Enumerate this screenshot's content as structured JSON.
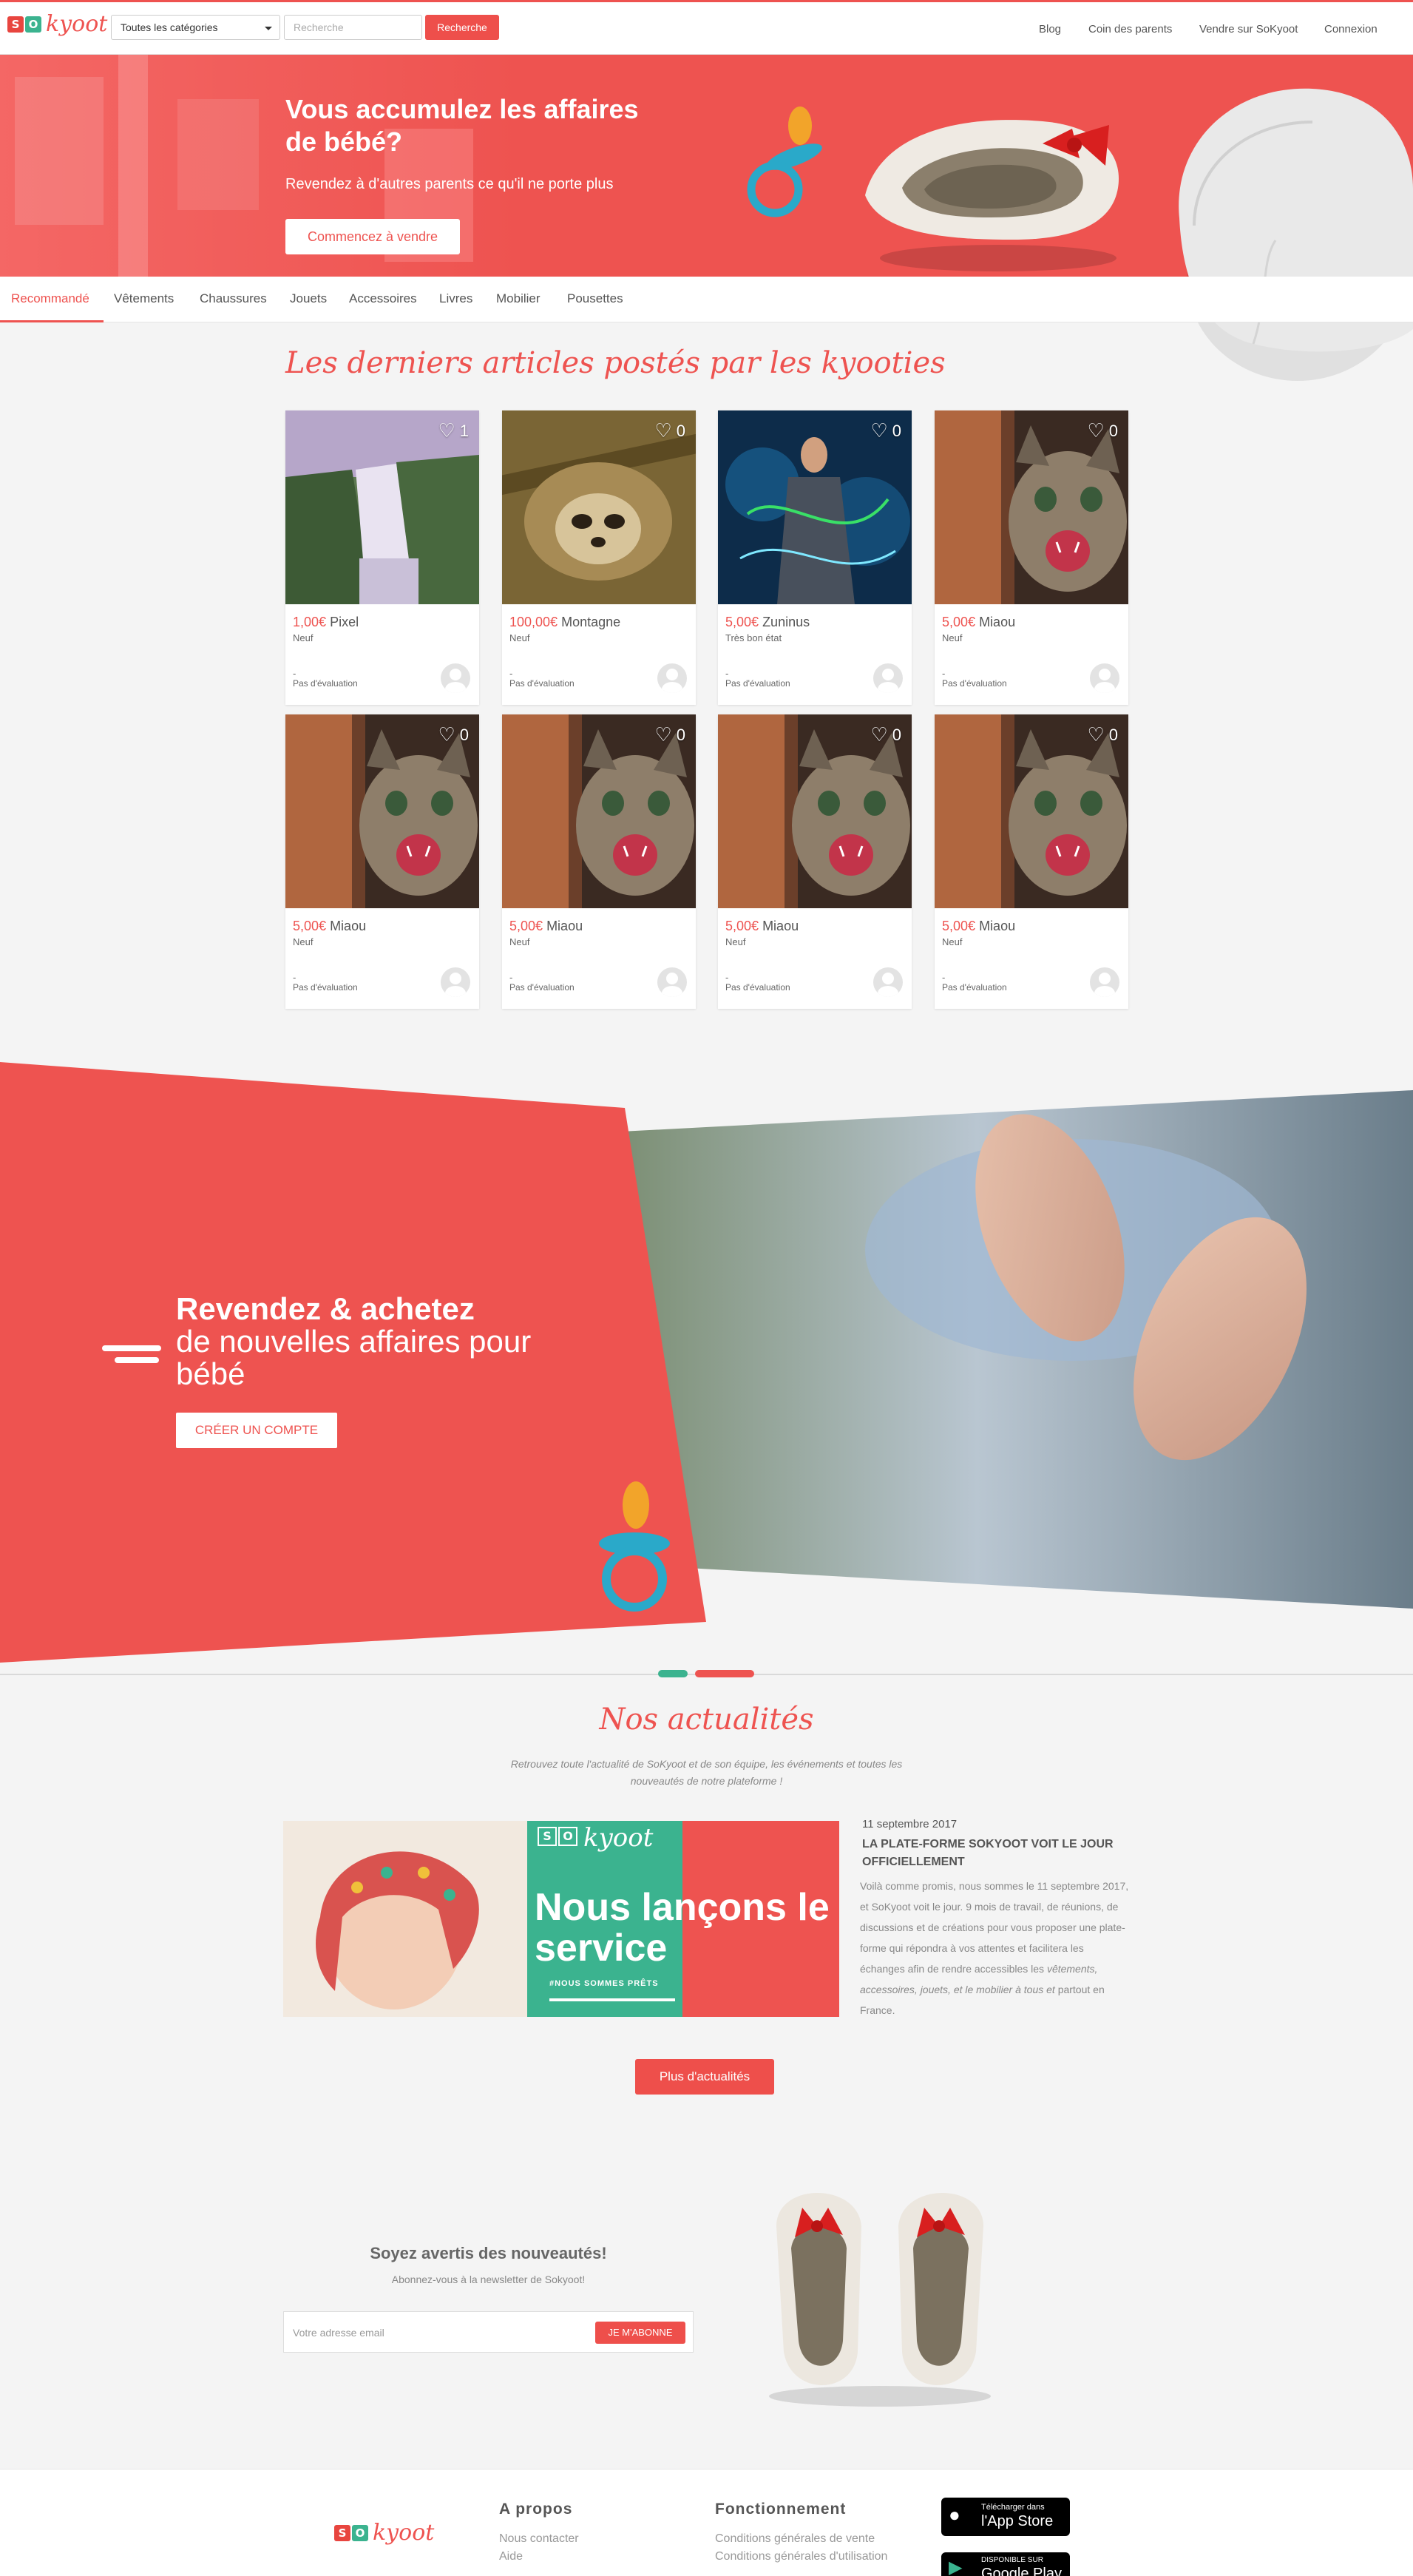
{
  "header": {
    "logo_letters": [
      "S",
      "O"
    ],
    "logo_word": "kyoot",
    "category_select": "Toutes les catégories",
    "search_placeholder": "Recherche",
    "search_button": "Recherche",
    "nav": [
      "Blog",
      "Coin des parents",
      "Vendre sur SoKyoot",
      "Connexion"
    ]
  },
  "hero": {
    "title": "Vous accumulez les affaires de bébé?",
    "subtitle": "Revendez à d'autres parents ce qu'il ne porte plus",
    "cta": "Commencez à vendre"
  },
  "tabs": [
    "Recommandé",
    "Vêtements",
    "Chaussures",
    "Jouets",
    "Accessoires",
    "Livres",
    "Mobilier",
    "Pousettes"
  ],
  "latest": {
    "title": "Les derniers articles postés par les kyooties",
    "items": [
      {
        "likes": "1",
        "price": "1,00€",
        "name": "Pixel",
        "condition": "Neuf",
        "dash": "-",
        "rating": "Pas d'évaluation",
        "image": "waterfall"
      },
      {
        "likes": "0",
        "price": "100,00€",
        "name": "Montagne",
        "condition": "Neuf",
        "dash": "-",
        "rating": "Pas d'évaluation",
        "image": "sloth"
      },
      {
        "likes": "0",
        "price": "5,00€",
        "name": "Zuninus",
        "condition": "Très bon état",
        "dash": "-",
        "rating": "Pas d'évaluation",
        "image": "light-man"
      },
      {
        "likes": "0",
        "price": "5,00€",
        "name": "Miaou",
        "condition": "Neuf",
        "dash": "-",
        "rating": "Pas d'évaluation",
        "image": "kitten"
      },
      {
        "likes": "0",
        "price": "5,00€",
        "name": "Miaou",
        "condition": "Neuf",
        "dash": "-",
        "rating": "Pas d'évaluation",
        "image": "kitten"
      },
      {
        "likes": "0",
        "price": "5,00€",
        "name": "Miaou",
        "condition": "Neuf",
        "dash": "-",
        "rating": "Pas d'évaluation",
        "image": "kitten"
      },
      {
        "likes": "0",
        "price": "5,00€",
        "name": "Miaou",
        "condition": "Neuf",
        "dash": "-",
        "rating": "Pas d'évaluation",
        "image": "kitten"
      },
      {
        "likes": "0",
        "price": "5,00€",
        "name": "Miaou",
        "condition": "Neuf",
        "dash": "-",
        "rating": "Pas d'évaluation",
        "image": "kitten"
      }
    ]
  },
  "promo": {
    "title": "Revendez & achetez",
    "subtitle": "de nouvelles affaires pour bébé",
    "cta": "CRÉER UN COMPTE"
  },
  "news": {
    "title": "Nos actualités",
    "intro": "Retrouvez toute l'actualité de SoKyoot et de son équipe, les événements et toutes les nouveautés de notre plateforme !",
    "image_headline": "Nous lançons le service",
    "image_tag": "#NOUS SOMMES PRÊTS",
    "image_logo_word": "kyoot",
    "date": "11 septembre 2017",
    "article_title": "LA PLATE-FORME SOKYOOT VOIT LE JOUR OFFICIELLEMENT",
    "body_1": "Voilà comme promis, nous sommes le 11 septembre 2017, et SoKyoot voit le jour. 9 mois de travail, de réunions, de discussions et de créations pour vous proposer une plate-forme qui répondra à vos attentes et facilitera les échanges afin de rendre accessibles les",
    "body_italic": "vêtements, accessoires, jouets, et le mobilier à tous et",
    "body_2": "partout en France.",
    "more_button": "Plus d'actualités"
  },
  "newsletter": {
    "title": "Soyez avertis des nouveautés!",
    "subtitle": "Abonnez-vous à la newsletter de Sokyoot!",
    "email_placeholder": "Votre adresse email",
    "button": "JE M'ABONNE"
  },
  "footer": {
    "about_title": "A propos",
    "about_links": [
      "Nous contacter",
      "Aide"
    ],
    "how_title": "Fonctionnement",
    "how_links": [
      "Conditions générales de vente",
      "Conditions générales d'utilisation"
    ],
    "appstore_small": "Télécharger dans",
    "appstore_big": "l'App Store",
    "google_small": "DISPONIBLE SUR",
    "google_big": "Google Play"
  },
  "colors": {
    "brand_red": "#ee5350",
    "logo_red": "#e8453f",
    "logo_green": "#3bb38f",
    "accent_teal": "#2aa9c9"
  }
}
